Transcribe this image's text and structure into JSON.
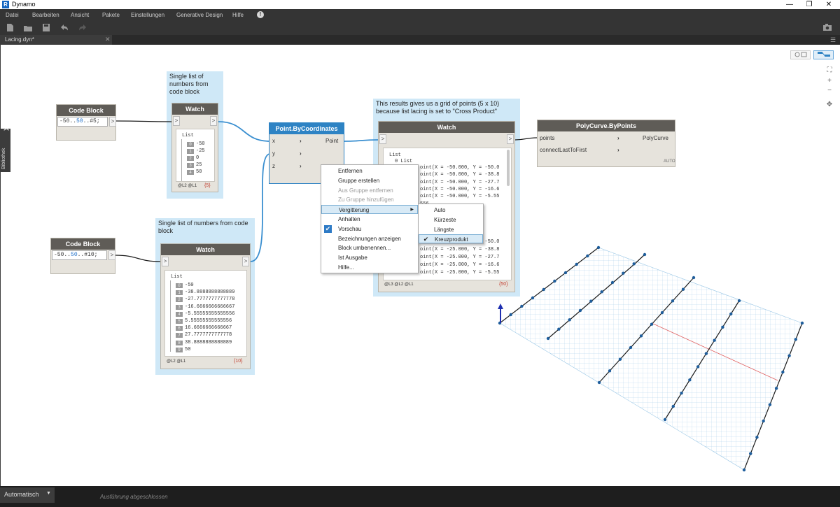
{
  "app": {
    "title": "Dynamo",
    "logo": "R"
  },
  "menu": [
    "Datei",
    "Bearbeiten",
    "Ansicht",
    "Pakete",
    "Einstellungen",
    "Generative Design",
    "Hilfe"
  ],
  "menu_info": "!",
  "window_controls": {
    "minimize": "—",
    "maximize": "❐",
    "close": "✕"
  },
  "toolbar": {
    "new": "new-file-icon",
    "open": "open-icon",
    "save": "save-icon",
    "undo": "undo-icon",
    "redo": "redo-icon",
    "screenshot": "camera-icon"
  },
  "tab": {
    "label": "Lacing.dyn*",
    "close": "✕"
  },
  "library_tab": "Bibliothek",
  "library_arrow": "❯",
  "groups": {
    "g1": "Single list of numbers from code block",
    "g2": "Single list of numbers from code block",
    "g3": "This results gives us a grid of points (5 x 10) because list lacing is set to \"Cross Product\""
  },
  "code1": {
    "title": "Code Block",
    "code_a": "-50",
    "code_b": "..",
    "code_c": "50",
    "code_d": "..#5;",
    "out": ">"
  },
  "code2": {
    "title": "Code Block",
    "code_a": "-50",
    "code_b": "..",
    "code_c": "50",
    "code_d": "..#10;",
    "out": ">"
  },
  "watch1": {
    "title": "Watch",
    "in": ">",
    "out": ">",
    "list_label": "List",
    "items": [
      {
        "i": "0",
        "v": "-50"
      },
      {
        "i": "1",
        "v": "-25"
      },
      {
        "i": "2",
        "v": "0"
      },
      {
        "i": "3",
        "v": "25"
      },
      {
        "i": "4",
        "v": "50"
      }
    ],
    "levels": "@L2 @L1",
    "count": "{5}"
  },
  "watch2": {
    "title": "Watch",
    "in": ">",
    "out": ">",
    "list_label": "List",
    "items": [
      {
        "i": "0",
        "v": "-50"
      },
      {
        "i": "1",
        "v": "-38.8888888888889"
      },
      {
        "i": "2",
        "v": "-27.7777777777778"
      },
      {
        "i": "3",
        "v": "-16.6666666666667"
      },
      {
        "i": "4",
        "v": "-5.55555555555556"
      },
      {
        "i": "5",
        "v": "5.55555555555556"
      },
      {
        "i": "6",
        "v": "16.6666666666667"
      },
      {
        "i": "7",
        "v": "27.7777777777778"
      },
      {
        "i": "8",
        "v": "38.8888888888889"
      },
      {
        "i": "9",
        "v": "50"
      }
    ],
    "levels": "@L2 @L1",
    "count": "{10}"
  },
  "point_node": {
    "title": "Point.ByCoordinates",
    "in_x": "x",
    "in_y": "y",
    "in_z": "z",
    "out": "Point"
  },
  "watch3": {
    "title": "Watch",
    "in": ">",
    "out": ">",
    "list_label": "List",
    "sublist": "0 List",
    "lines": [
      "oint(X = -50.000, Y = -50.0",
      "oint(X = -50.000, Y = -38.8",
      "oint(X = -50.000, Y = -27.7",
      "oint(X = -50.000, Y = -16.6",
      "oint(X = -50.000, Y = -5.55",
      "556",
      "16.66",
      "27.77",
      "38.88",
      "50.00"
    ],
    "lines2": [
      "oint(X = -25.000, Y = -50.0",
      "oint(X = -25.000, Y = -38.8",
      "oint(X = -25.000, Y = -27.7",
      "oint(X = -25.000, Y = -16.6",
      "oint(X = -25.000, Y = -5.55"
    ],
    "levels": "@L3 @L2 @L1",
    "count": "{50}"
  },
  "polycurve": {
    "title": "PolyCurve.ByPoints",
    "in_points": "points",
    "in_connect": "connectLastToFirst",
    "out": "PolyCurve",
    "lacing": "AUTO"
  },
  "context_menu": [
    {
      "label": "Entfernen",
      "enabled": true,
      "checked": false,
      "submenu": false
    },
    {
      "label": "Gruppe erstellen",
      "enabled": true,
      "checked": false,
      "submenu": false
    },
    {
      "label": "Aus Gruppe entfernen",
      "enabled": false,
      "checked": false,
      "submenu": false
    },
    {
      "label": "Zu Gruppe hinzufügen",
      "enabled": false,
      "checked": false,
      "submenu": false
    },
    {
      "label": "Vergitterung",
      "enabled": true,
      "checked": false,
      "submenu": true
    },
    {
      "label": "Anhalten",
      "enabled": true,
      "checked": false,
      "submenu": false
    },
    {
      "label": "Vorschau",
      "enabled": true,
      "checked": true,
      "submenu": false
    },
    {
      "label": "Bezeichnungen anzeigen",
      "enabled": true,
      "checked": false,
      "submenu": false
    },
    {
      "label": "Block umbenennen...",
      "enabled": true,
      "checked": false,
      "submenu": false
    },
    {
      "label": "Ist Ausgabe",
      "enabled": true,
      "checked": false,
      "submenu": false
    },
    {
      "label": "Hilfe...",
      "enabled": true,
      "checked": false,
      "submenu": false
    }
  ],
  "lacing_menu": [
    {
      "label": "Auto",
      "checked": false
    },
    {
      "label": "Kürzeste",
      "checked": false
    },
    {
      "label": "Längste",
      "checked": false
    },
    {
      "label": "Kreuzprodukt",
      "checked": true
    }
  ],
  "submenu_arrow": "▶",
  "check_glyph": "✔",
  "view_toggle": {
    "geometry": "geometry-view-icon",
    "graph": "graph-view-icon"
  },
  "zoom": {
    "fit": "⛶",
    "in": "+",
    "out": "−",
    "pan": "✥"
  },
  "status": {
    "run_mode": "Automatisch",
    "dropdown": "▼",
    "message": "Ausführung abgeschlossen"
  },
  "colors": {
    "wire": "#3a8fd0",
    "node_header": "#5f5c57",
    "selected_header": "#2e83c4",
    "group": "#cfe8f7",
    "grid": "#9cc8e6",
    "curve": "#1b1b1b",
    "point": "#1f5e9c"
  }
}
